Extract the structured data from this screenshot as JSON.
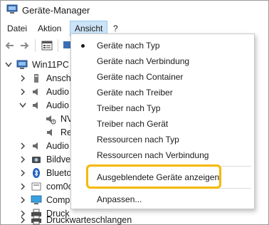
{
  "window": {
    "title": "Geräte-Manager"
  },
  "menubar": {
    "items": [
      "Datei",
      "Aktion",
      "Ansicht",
      "?"
    ]
  },
  "tree": {
    "root": "Win11PC",
    "rows": [
      {
        "label": "Ansch",
        "icon": "ports-icon"
      },
      {
        "label": "Audio",
        "icon": "audio-icon"
      },
      {
        "label": "Audio",
        "icon": "audio-icon"
      },
      {
        "label": "NV",
        "icon": "audio-device-icon"
      },
      {
        "label": "Re",
        "icon": "speaker-icon"
      },
      {
        "label": "Audio",
        "icon": "audio-icon"
      },
      {
        "label": "Bildve",
        "icon": "camera-icon"
      },
      {
        "label": "Blueto",
        "icon": "bluetooth-icon"
      },
      {
        "label": "com0c",
        "icon": "com-icon"
      },
      {
        "label": "Comp",
        "icon": "computer-icon"
      },
      {
        "label": "Druck",
        "icon": "printer-icon"
      },
      {
        "label": "Druckwarteschlangen",
        "icon": "printer-icon"
      }
    ]
  },
  "dropdown": {
    "items": [
      "Geräte nach Typ",
      "Geräte nach Verbindung",
      "Geräte nach Container",
      "Geräte nach Treiber",
      "Treiber nach Typ",
      "Treiber nach Gerät",
      "Ressourcen nach Typ",
      "Ressourcen nach Verbindung"
    ],
    "hidden_devices": "Ausgeblendete Geräte anzeigen",
    "customize": "Anpassen...",
    "selected_index": 0
  },
  "colors": {
    "highlight": "#f5b800",
    "menu_active": "#cce4f7"
  }
}
